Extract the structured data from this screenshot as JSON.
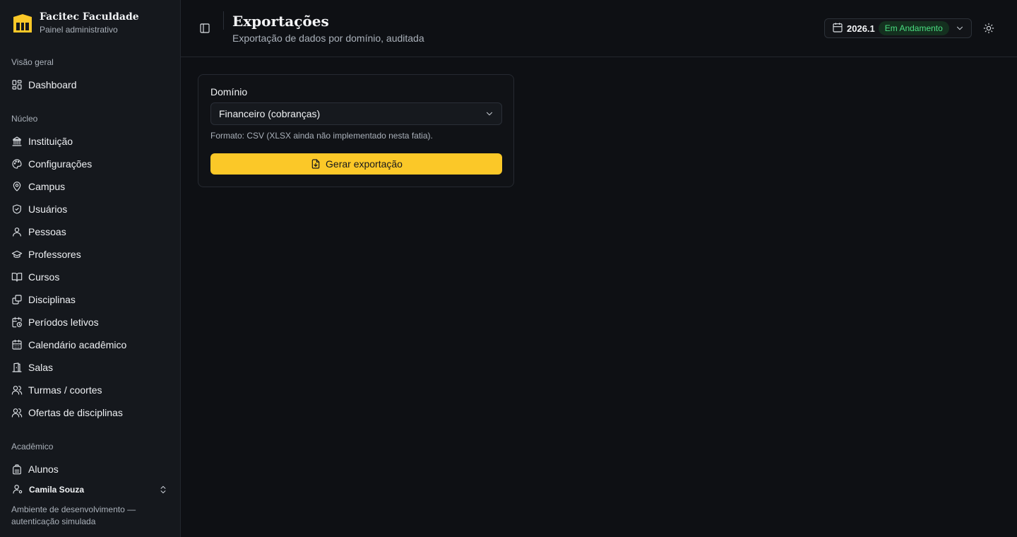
{
  "brand": {
    "name": "Facitec Faculdade",
    "subtitle": "Painel administrativo",
    "logo_icon": "facitec-logo",
    "logo_color": "#fbc828"
  },
  "sidebar": {
    "sections": [
      {
        "label": "Visão geral",
        "items": [
          {
            "label": "Dashboard",
            "icon": "dashboard-icon"
          }
        ]
      },
      {
        "label": "Núcleo",
        "items": [
          {
            "label": "Instituição",
            "icon": "landmark-icon"
          },
          {
            "label": "Configurações",
            "icon": "palette-icon"
          },
          {
            "label": "Campus",
            "icon": "map-pin-icon"
          },
          {
            "label": "Usuários",
            "icon": "shield-icon"
          },
          {
            "label": "Pessoas",
            "icon": "user-icon"
          },
          {
            "label": "Professores",
            "icon": "graduation-cap-icon"
          },
          {
            "label": "Cursos",
            "icon": "book-open-icon"
          },
          {
            "label": "Disciplinas",
            "icon": "copy-icon"
          },
          {
            "label": "Períodos letivos",
            "icon": "calendar-clock-icon"
          },
          {
            "label": "Calendário acadêmico",
            "icon": "calendar-icon"
          },
          {
            "label": "Salas",
            "icon": "door-icon"
          },
          {
            "label": "Turmas / coortes",
            "icon": "users-icon"
          },
          {
            "label": "Ofertas de disciplinas",
            "icon": "users-icon"
          }
        ]
      },
      {
        "label": "Acadêmico",
        "items": [
          {
            "label": "Alunos",
            "icon": "backpack-icon"
          }
        ]
      }
    ],
    "user": {
      "name": "Camila Souza",
      "icon": "user-cog-icon"
    },
    "env_note": "Ambiente de desenvolvimento — autenticação simulada"
  },
  "header": {
    "title": "Exportações",
    "subtitle": "Exportação de dados por domínio, auditada",
    "period": {
      "code": "2026.1",
      "status": "Em Andamento",
      "status_color": "#4ade80"
    }
  },
  "export_card": {
    "field_label": "Domínio",
    "selected_domain": "Financeiro (cobranças)",
    "hint": "Formato: CSV (XLSX ainda não implementado nesta fatia).",
    "button_label": "Gerar exportação",
    "button_color": "#fbc828"
  }
}
